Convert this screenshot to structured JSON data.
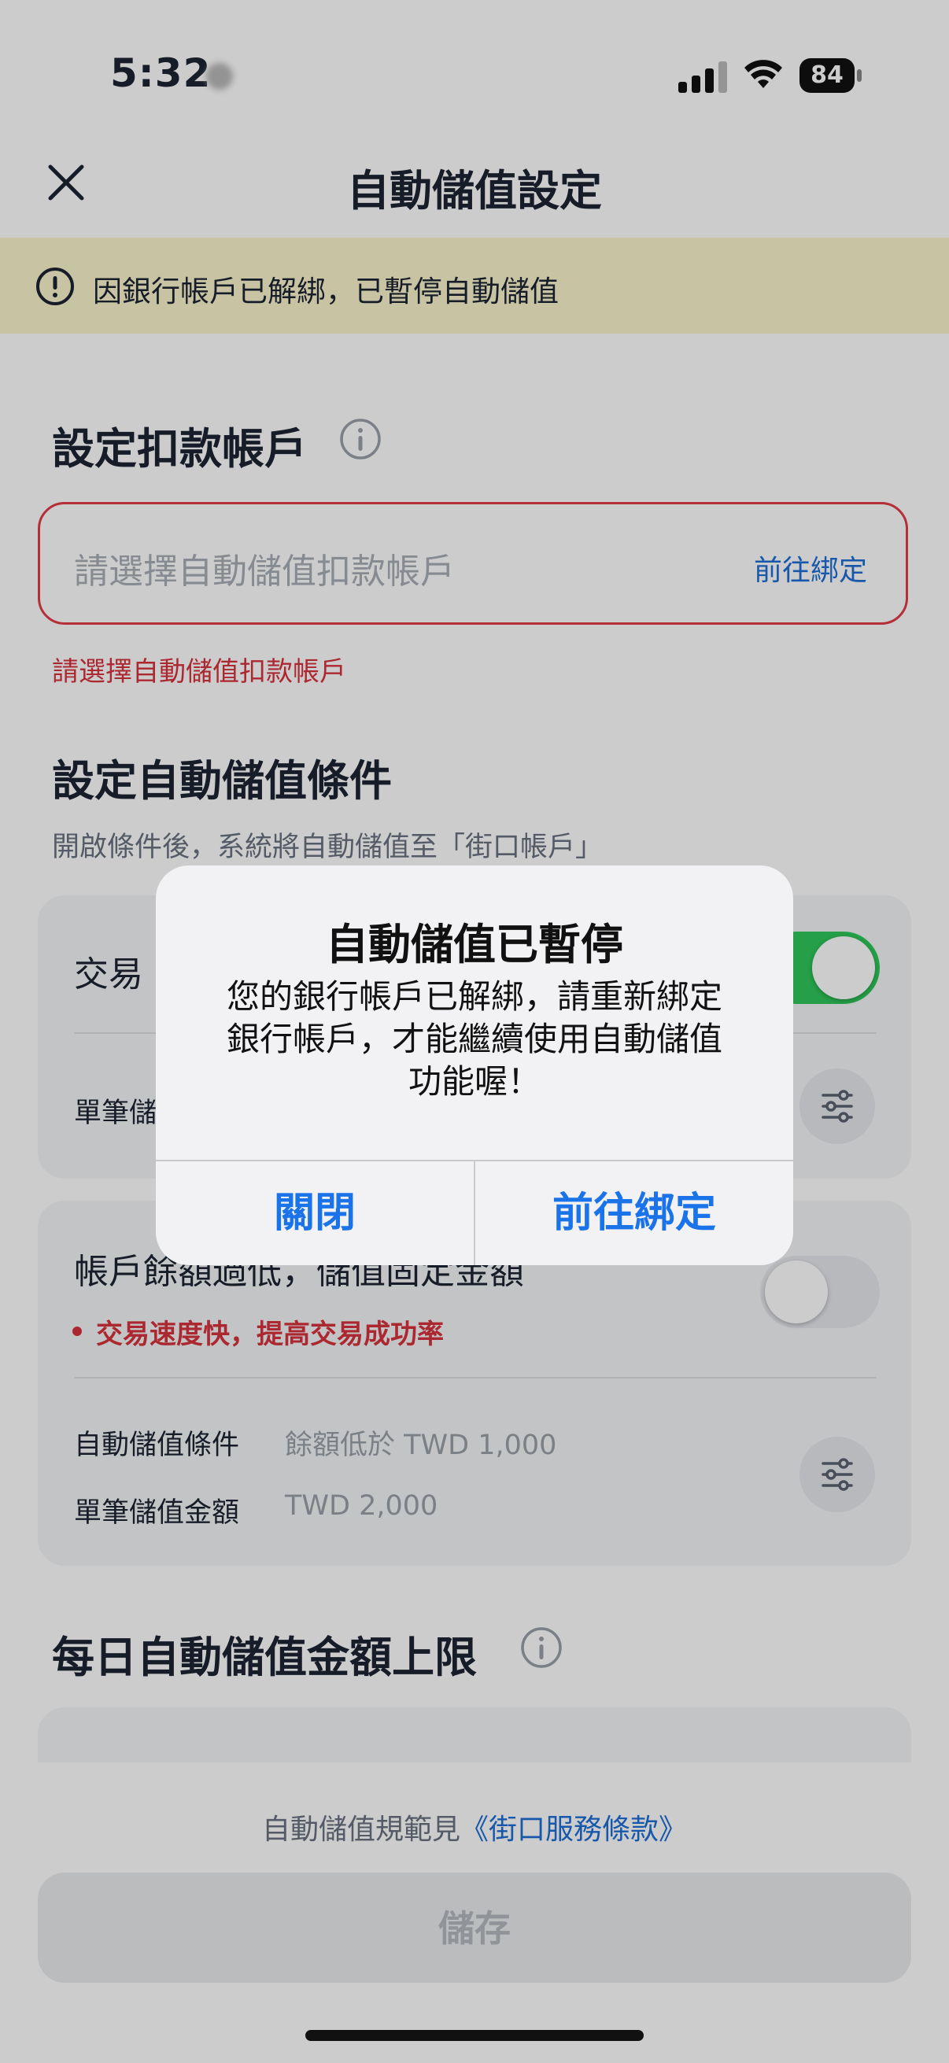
{
  "status_bar": {
    "time": "5:32",
    "battery": "84"
  },
  "header": {
    "title": "自動儲值設定"
  },
  "banner": {
    "text": "因銀行帳戶已解綁，已暫停自動儲值"
  },
  "section_account": {
    "title": "設定扣款帳戶",
    "placeholder": "請選擇自動儲值扣款帳戶",
    "link": "前往綁定",
    "error": "請選擇自動儲值扣款帳戶"
  },
  "section_conditions": {
    "title": "設定自動儲值條件",
    "subtitle": "開啟條件後，系統將自動儲值至「街口帳戶」",
    "card1": {
      "title": "交易",
      "toggle_on": true,
      "row1_label": "單筆儲"
    },
    "card2": {
      "title": "帳戶餘額過低，儲值固定金額",
      "note": "交易速度快，提高交易成功率",
      "toggle_on": false,
      "row1_label": "自動儲值條件",
      "row1_value": "餘額低於 TWD 1,000",
      "row2_label": "單筆儲值金額",
      "row2_value": "TWD 2,000"
    }
  },
  "section_limit": {
    "title": "每日自動儲值金額上限"
  },
  "footer": {
    "terms_prefix": "自動儲值規範見",
    "terms_link": "《街口服務條款》",
    "save_label": "儲存"
  },
  "dialog": {
    "title": "自動儲值已暫停",
    "message": "您的銀行帳戶已解綁，請重新綁定銀行帳戶，才能繼續使用自動儲值功能喔！",
    "cancel_label": "關閉",
    "confirm_label": "前往綁定"
  },
  "colors": {
    "accent": "#1f6fd6",
    "error": "#d8323c",
    "toggle_on": "#2fc75a",
    "banner_bg": "#fbf6cc"
  }
}
